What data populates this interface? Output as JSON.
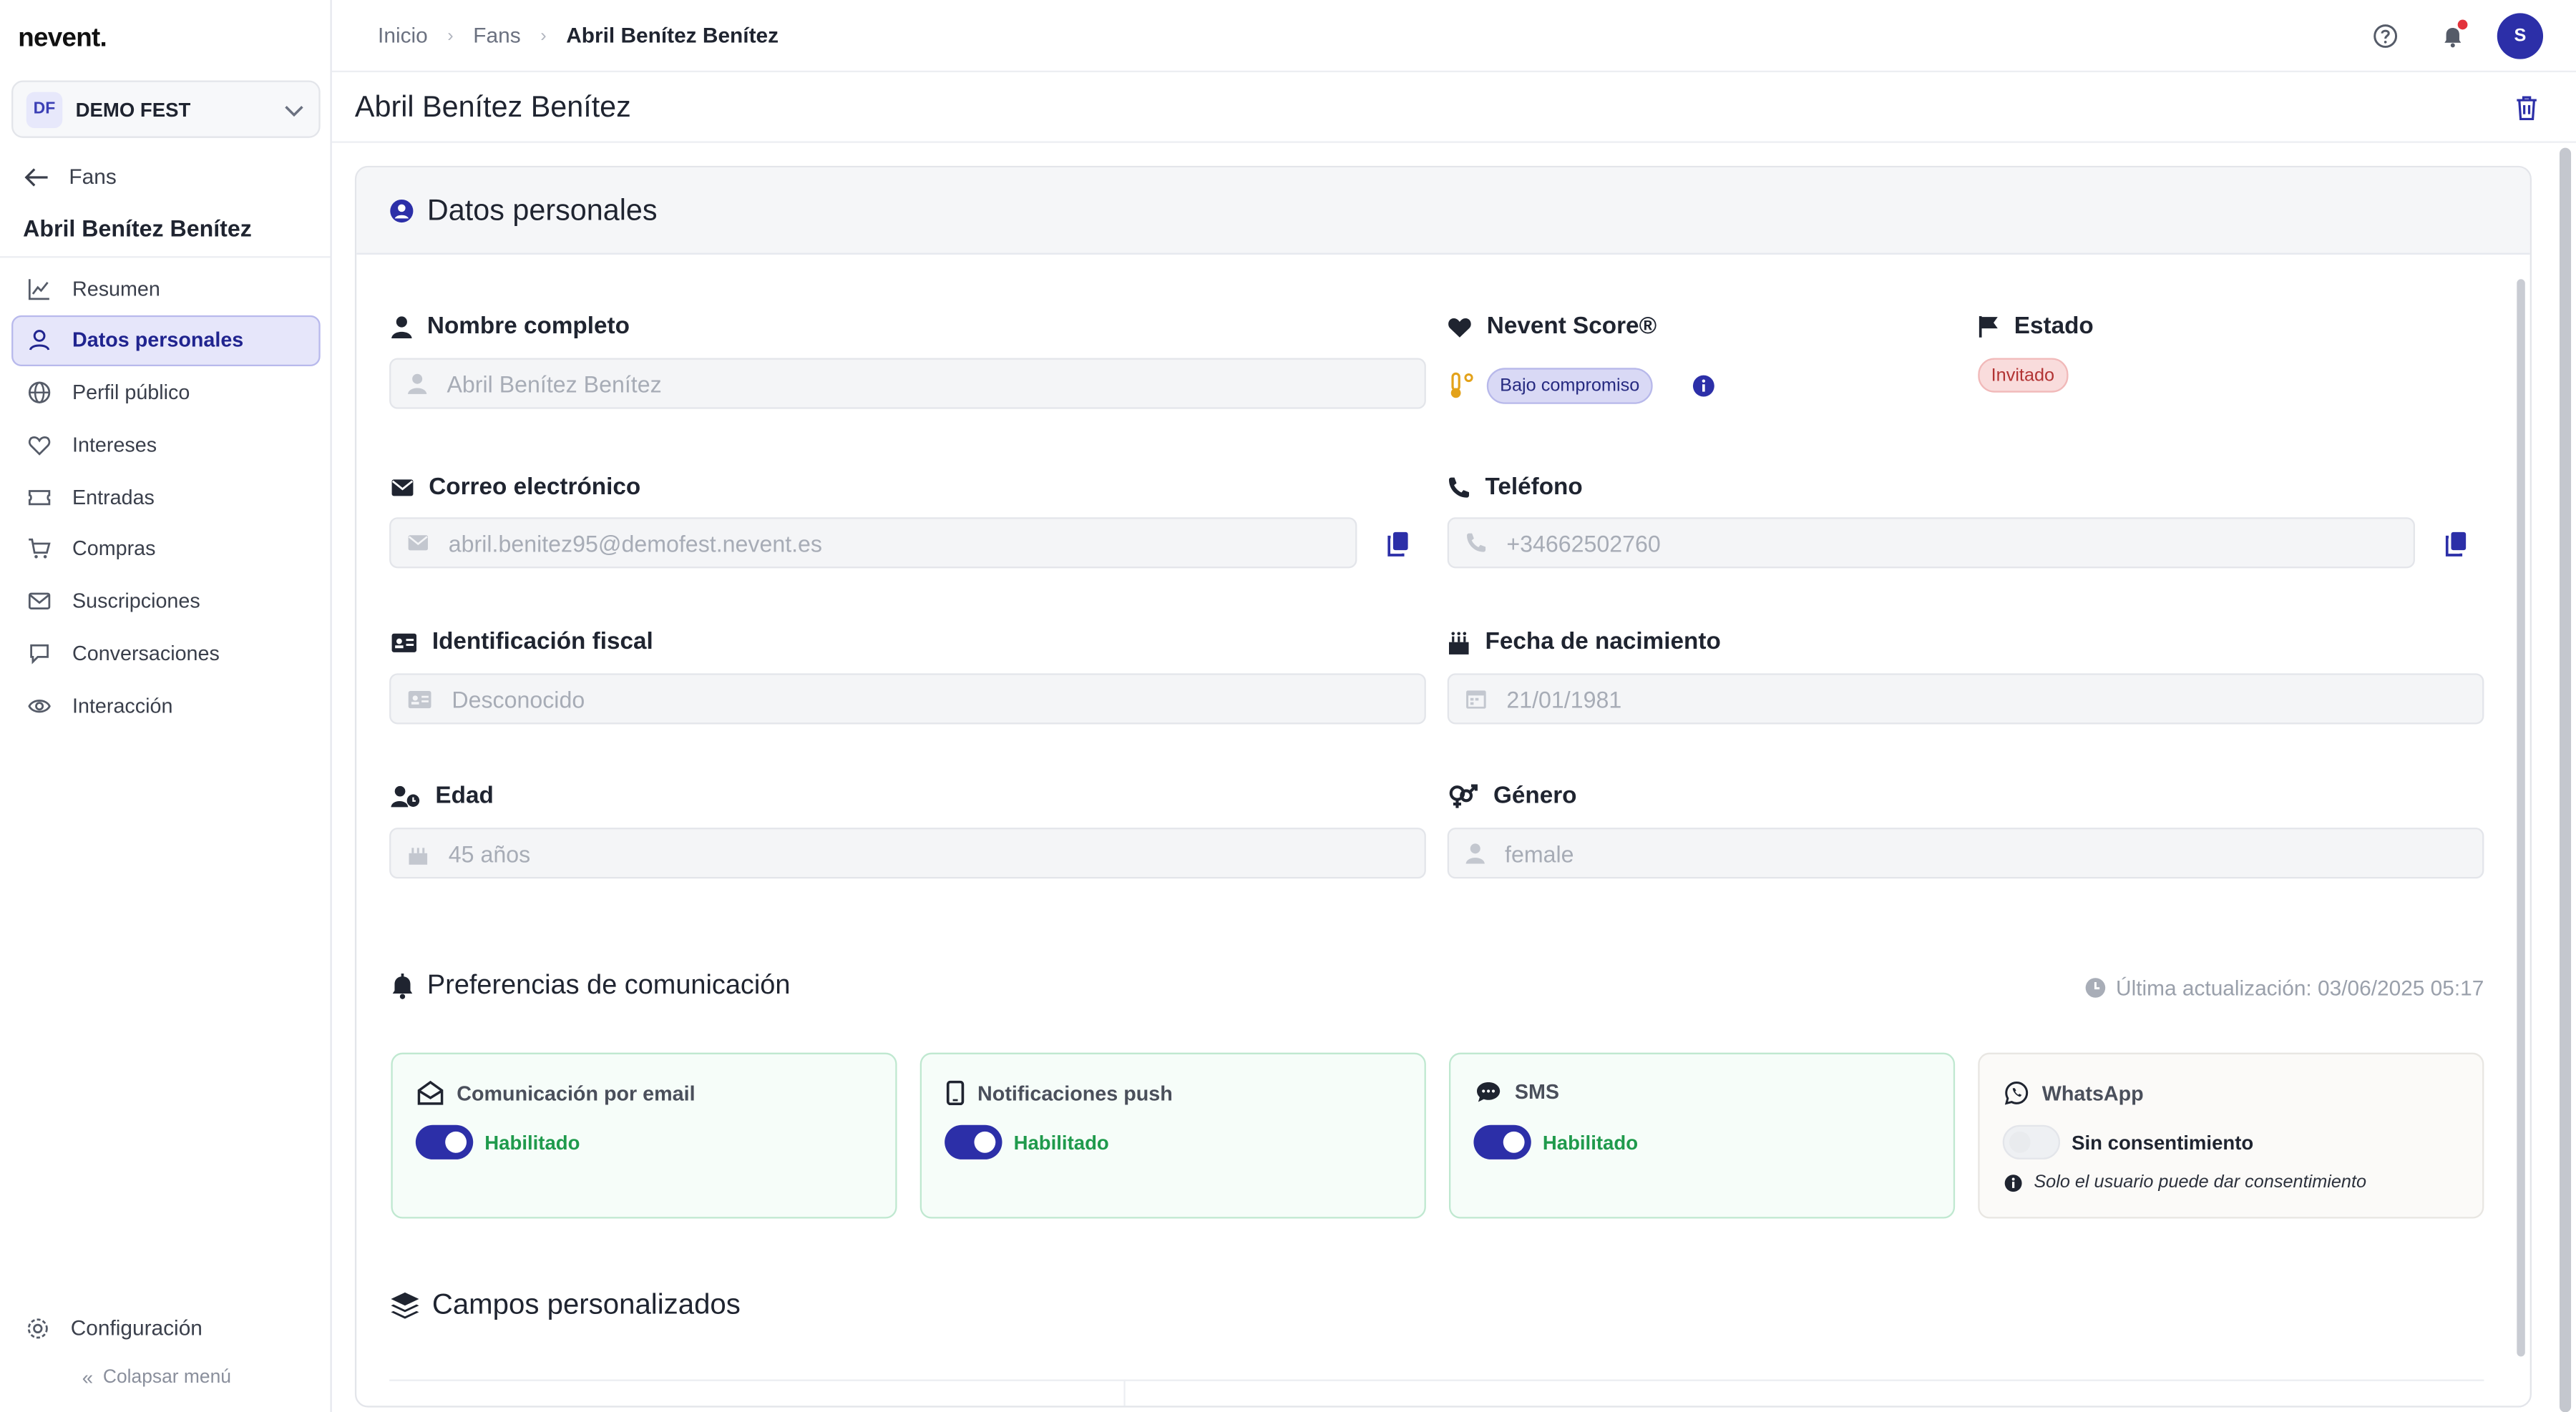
{
  "brand": "nevent.",
  "org": {
    "initials": "DF",
    "name": "DEMO FEST"
  },
  "sidebar": {
    "back_label": "Fans",
    "fan_name": "Abril Benítez Benítez",
    "items": [
      {
        "label": "Resumen",
        "icon": "chart-line-icon"
      },
      {
        "label": "Datos personales",
        "icon": "user-icon"
      },
      {
        "label": "Perfil público",
        "icon": "globe-icon"
      },
      {
        "label": "Intereses",
        "icon": "heart-icon"
      },
      {
        "label": "Entradas",
        "icon": "ticket-icon"
      },
      {
        "label": "Compras",
        "icon": "cart-icon"
      },
      {
        "label": "Suscripciones",
        "icon": "mail-icon"
      },
      {
        "label": "Conversaciones",
        "icon": "chat-icon"
      },
      {
        "label": "Interacción",
        "icon": "eye-icon"
      }
    ],
    "config_label": "Configuración",
    "collapse_label": "Colapsar menú"
  },
  "breadcrumb": {
    "items": [
      "Inicio",
      "Fans"
    ],
    "current": "Abril Benítez Benítez"
  },
  "user_initial": "S",
  "page": {
    "title": "Abril Benítez Benítez"
  },
  "section": {
    "title": "Datos personales"
  },
  "fields": {
    "full_name": {
      "label": "Nombre completo",
      "value": "Abril Benítez Benítez"
    },
    "score": {
      "label": "Nevent Score®",
      "badge": "Bajo compromiso"
    },
    "estado": {
      "label": "Estado",
      "badge": "Invitado"
    },
    "email": {
      "label": "Correo electrónico",
      "value": "abril.benitez95@demofest.nevent.es"
    },
    "phone": {
      "label": "Teléfono",
      "value": "+34662502760"
    },
    "tax_id": {
      "label": "Identificación fiscal",
      "value": "Desconocido"
    },
    "birth": {
      "label": "Fecha de nacimiento",
      "value": "21/01/1981"
    },
    "age": {
      "label": "Edad",
      "value": "45 años"
    },
    "gender": {
      "label": "Género",
      "value": "female"
    }
  },
  "communication": {
    "title": "Preferencias de comunicación",
    "updated": "Última actualización: 03/06/2025 05:17",
    "channels": [
      {
        "label": "Comunicación por email",
        "status": "Habilitado",
        "enabled": true
      },
      {
        "label": "Notificaciones push",
        "status": "Habilitado",
        "enabled": true
      },
      {
        "label": "SMS",
        "status": "Habilitado",
        "enabled": true
      },
      {
        "label": "WhatsApp",
        "status": "Sin consentimiento",
        "enabled": false,
        "note": "Solo el usuario puede dar consentimiento"
      }
    ]
  },
  "custom_fields": {
    "title": "Campos personalizados"
  },
  "colors": {
    "accent": "#2c2fa8",
    "enabled_text": "#1f9a4c",
    "estado_badge": "#f9dcdc"
  }
}
